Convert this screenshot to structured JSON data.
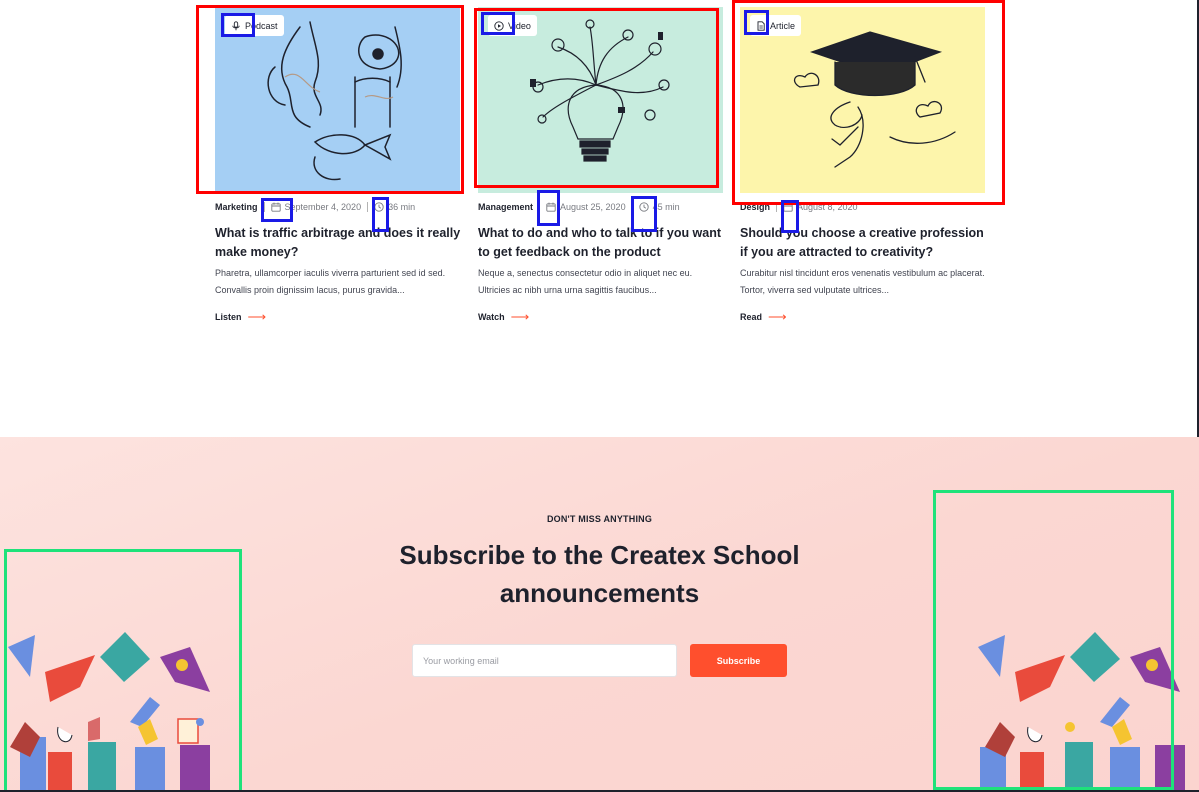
{
  "cards": [
    {
      "badge": "Podcast",
      "badge_icon": "microphone-icon",
      "category": "Marketing",
      "date": "September 4, 2020",
      "duration": "36 min",
      "title": "What is traffic arbitrage and does it really make money?",
      "excerpt": "Pharetra, ullamcorper iaculis viverra parturient sed id sed. Convallis proin dignissim lacus, purus gravida...",
      "action": "Listen",
      "image_bg": "#a5cff4"
    },
    {
      "badge": "Video",
      "badge_icon": "play-circle-icon",
      "category": "Management",
      "date": "August 25, 2020",
      "duration": "45 min",
      "title": "What to do and who to talk to if you want to get feedback on the product",
      "excerpt": "Neque a, senectus consectetur odio in aliquet nec eu. Ultricies ac nibh urna urna sagittis faucibus...",
      "action": "Watch",
      "image_bg": "#c7ecde"
    },
    {
      "badge": "Article",
      "badge_icon": "document-icon",
      "category": "Design",
      "date": "August 8, 2020",
      "duration": "",
      "title": "Should you choose a creative profession if you are attracted to creativity?",
      "excerpt": "Curabitur nisl tincidunt eros venenatis vestibulum ac placerat. Tortor, viverra sed vulputate ultrices...",
      "action": "Read",
      "image_bg": "#fdf5ab"
    }
  ],
  "subscribe": {
    "eyebrow": "DON'T MISS ANYTHING",
    "title": "Subscribe to the Createx School announcements",
    "email_placeholder": "Your working email",
    "button_label": "Subscribe"
  },
  "colors": {
    "accent": "#ff4f2d",
    "text_dark": "#1e212c",
    "highlight_red": "#ff0000",
    "highlight_blue": "#1a1ae6",
    "highlight_green": "#1ee27a"
  }
}
